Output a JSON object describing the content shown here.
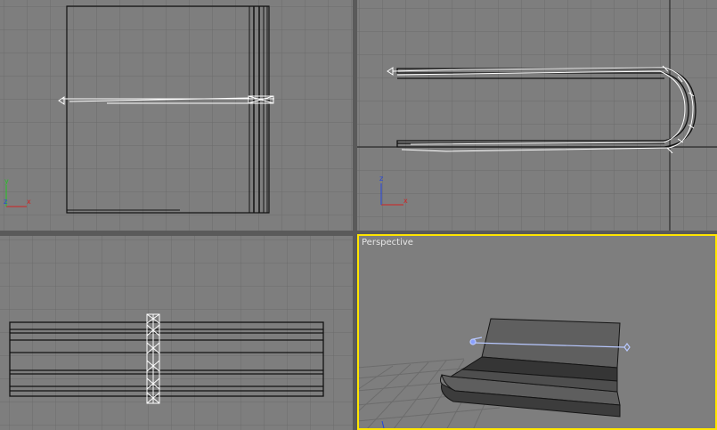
{
  "viewports": {
    "top": {
      "label": "",
      "active": false
    },
    "front": {
      "label": "",
      "active": false
    },
    "left": {
      "label": "",
      "active": false
    },
    "perspective": {
      "label": "Perspective",
      "active": true
    }
  },
  "axis_labels": {
    "x": "x",
    "y": "y",
    "z": "z"
  },
  "colors": {
    "viewport_bg": "#7e7e7e",
    "grid": "#6b6b6b",
    "active_border": "#ffe600",
    "selection_wire": "#ffffff",
    "axis_x": "#d22222",
    "axis_y": "#22c422",
    "axis_z": "#2244dd"
  }
}
